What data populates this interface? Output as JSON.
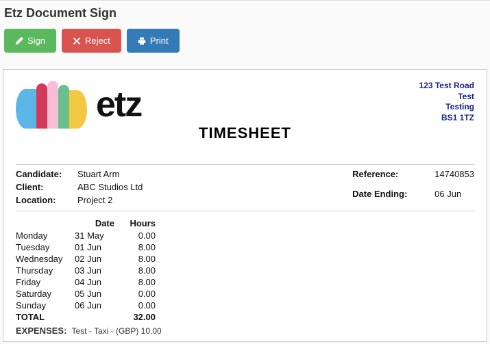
{
  "page_title": "Etz Document Sign",
  "buttons": {
    "sign": "Sign",
    "reject": "Reject",
    "print": "Print"
  },
  "logo_text": "etz",
  "address": {
    "line1": "123 Test Road",
    "line2": "Test",
    "line3": "Testing",
    "line4": "BS1 1TZ"
  },
  "doc_title": "TIMESHEET",
  "labels": {
    "candidate": "Candidate:",
    "client": "Client:",
    "location": "Location:",
    "reference": "Reference:",
    "date_ending": "Date Ending:",
    "date_col": "Date",
    "hours_col": "Hours",
    "total": "TOTAL",
    "expenses": "EXPENSES:"
  },
  "info": {
    "candidate": "Stuart Arm",
    "client": "ABC Studios Ltd",
    "location": "Project 2",
    "reference": "14740853",
    "date_ending": "06 Jun"
  },
  "rows": [
    {
      "day": "Monday",
      "date": "31 May",
      "hours": "0.00"
    },
    {
      "day": "Tuesday",
      "date": "01 Jun",
      "hours": "8.00"
    },
    {
      "day": "Wednesday",
      "date": "02 Jun",
      "hours": "8.00"
    },
    {
      "day": "Thursday",
      "date": "03 Jun",
      "hours": "8.00"
    },
    {
      "day": "Friday",
      "date": "04 Jun",
      "hours": "8.00"
    },
    {
      "day": "Saturday",
      "date": "05 Jun",
      "hours": "0.00"
    },
    {
      "day": "Sunday",
      "date": "06 Jun",
      "hours": "0.00"
    }
  ],
  "total_hours": "32.00",
  "expenses_text": "Test - Taxi - (GBP) 10.00"
}
